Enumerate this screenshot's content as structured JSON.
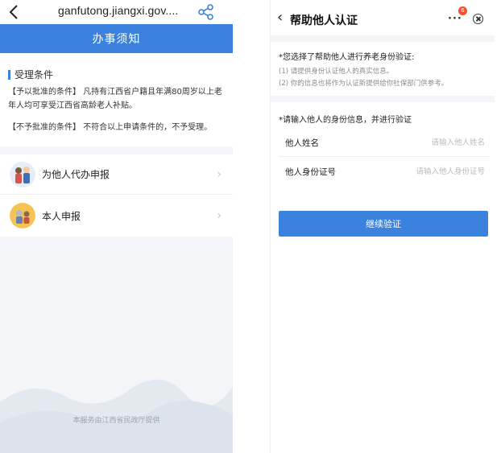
{
  "left": {
    "url": "ganfutong.jiangxi.gov....",
    "banner_title": "办事须知",
    "conditions": {
      "heading": "受理条件",
      "approve": "【予以批准的条件】 凡持有江西省户籍且年满80周岁以上老年人均可享受江西省高龄老人补贴。",
      "deny": "【不予批准的条件】 不符合以上申请条件的，不予受理。"
    },
    "menu": [
      {
        "label": "为他人代办申报",
        "icon": "family-avatar-icon"
      },
      {
        "label": "本人申报",
        "icon": "elder-avatar-icon"
      }
    ],
    "footer": "本服务由江西省民政厅提供"
  },
  "right": {
    "title": "帮助他人认证",
    "more": "···",
    "badge": "6",
    "notice": {
      "title": "*您选择了帮助他人进行养老身份验证:",
      "line1": "(1) 请提供身份认证他人的真实信息。",
      "line2": "(2) 你的信息也将作为认证新提供给你社保部门供参考。"
    },
    "form": {
      "title": "*请输入他人的身份信息，并进行验证",
      "name_label": "他人姓名",
      "name_placeholder": "请输入他人姓名",
      "id_label": "他人身份证号",
      "id_placeholder": "请输入他人身份证号"
    },
    "submit": "继续验证"
  },
  "colors": {
    "accent": "#3b82df",
    "badge": "#f0532d",
    "background": "#f3f5f8"
  }
}
